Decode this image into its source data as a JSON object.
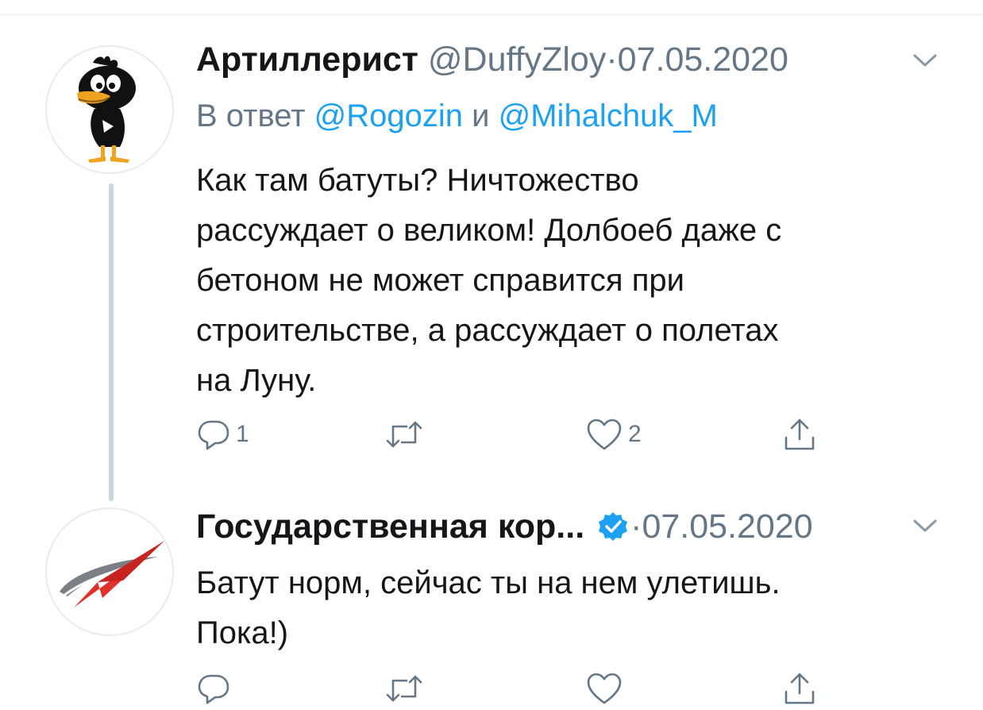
{
  "tweets": [
    {
      "author_name": "Артиллерист",
      "handle": "@DuffyZloy",
      "separator": "·",
      "date": "07.05.2020",
      "reply_to_prefix": "В ответ",
      "reply_mentions": [
        "@Rogozin",
        "@Mihalchuk_M"
      ],
      "reply_joiner": "и",
      "text_lines": [
        "Как там батуты? Ничтожество",
        "рассуждает о великом! Долбоеб даже с",
        "бетоном не может справится при",
        "строительстве, а рассуждает о полетах",
        "на Луну."
      ],
      "reply_count": "1",
      "retweet_count": "",
      "like_count": "2",
      "avatar_icon": "daffy-duck-avatar"
    },
    {
      "author_name": "Государственная кор...",
      "verified": true,
      "separator": "·",
      "date": "07.05.2020",
      "text_lines": [
        "Батут норм, сейчас ты на нем улетишь.",
        "Пока!)"
      ],
      "reply_count": "",
      "retweet_count": "",
      "like_count": "",
      "avatar_icon": "roscosmos-logo-avatar"
    }
  ],
  "colors": {
    "text": "#14171a",
    "muted": "#657786",
    "link": "#1da1f2",
    "thread_line": "#ccd6dd",
    "verified": "#1da1f2",
    "logo_red": "#e0312b",
    "logo_grey": "#7b8087"
  },
  "icons": {
    "reply": "reply-icon",
    "retweet": "retweet-icon",
    "like": "heart-icon",
    "share": "share-icon",
    "caret": "chevron-down-icon",
    "verified": "verified-badge-icon"
  }
}
